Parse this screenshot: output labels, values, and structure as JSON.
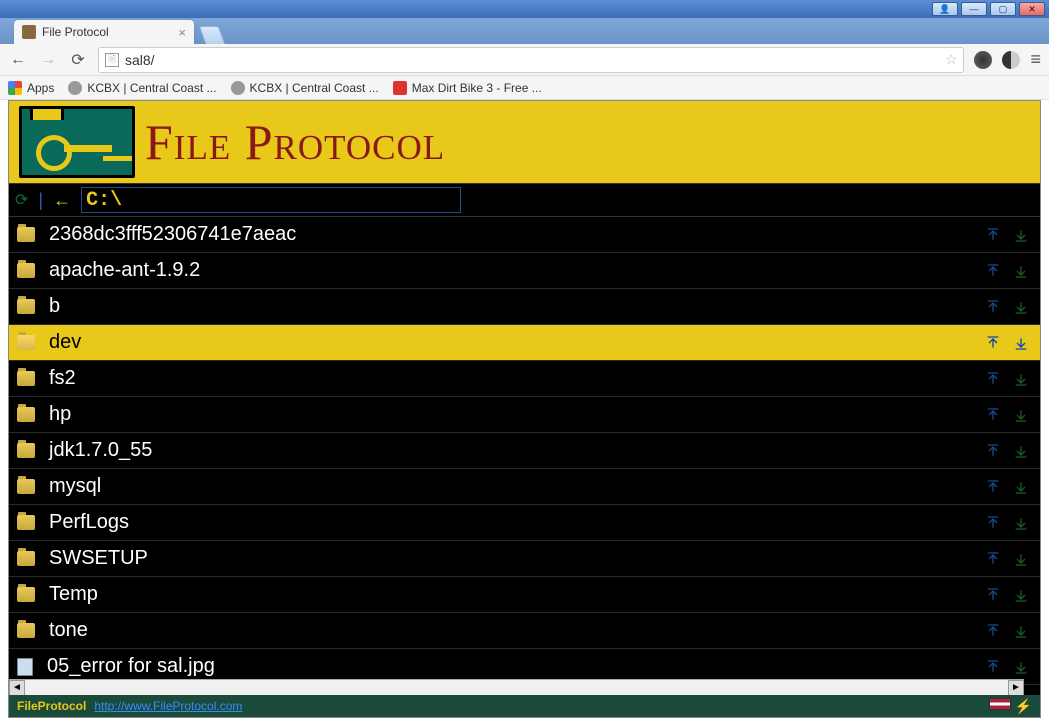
{
  "window": {
    "title": "File Protocol"
  },
  "browser": {
    "tab": {
      "title": "File Protocol"
    },
    "url": "sal8/",
    "bookmarks": {
      "apps": "Apps",
      "items": [
        {
          "label": "KCBX | Central Coast ...",
          "icon": "grey"
        },
        {
          "label": "KCBX | Central Coast ...",
          "icon": "grey"
        },
        {
          "label": "Max Dirt Bike 3 - Free ...",
          "icon": "red"
        }
      ]
    }
  },
  "app": {
    "title": "File Protocol",
    "path": "C:\\"
  },
  "files": [
    {
      "name": "2368dc3fff52306741e7aeac",
      "type": "folder",
      "selected": false
    },
    {
      "name": "apache-ant-1.9.2",
      "type": "folder",
      "selected": false
    },
    {
      "name": "b",
      "type": "folder",
      "selected": false
    },
    {
      "name": "dev",
      "type": "folder",
      "selected": true
    },
    {
      "name": "fs2",
      "type": "folder",
      "selected": false
    },
    {
      "name": "hp",
      "type": "folder",
      "selected": false
    },
    {
      "name": "jdk1.7.0_55",
      "type": "folder",
      "selected": false
    },
    {
      "name": "mysql",
      "type": "folder",
      "selected": false
    },
    {
      "name": "PerfLogs",
      "type": "folder",
      "selected": false
    },
    {
      "name": "SWSETUP",
      "type": "folder",
      "selected": false
    },
    {
      "name": "Temp",
      "type": "folder",
      "selected": false
    },
    {
      "name": "tone",
      "type": "folder",
      "selected": false
    },
    {
      "name": "05_error for sal.jpg",
      "type": "file",
      "selected": false
    }
  ],
  "status": {
    "name": "FileProtocol",
    "link": "http://www.FileProtocol.com"
  }
}
